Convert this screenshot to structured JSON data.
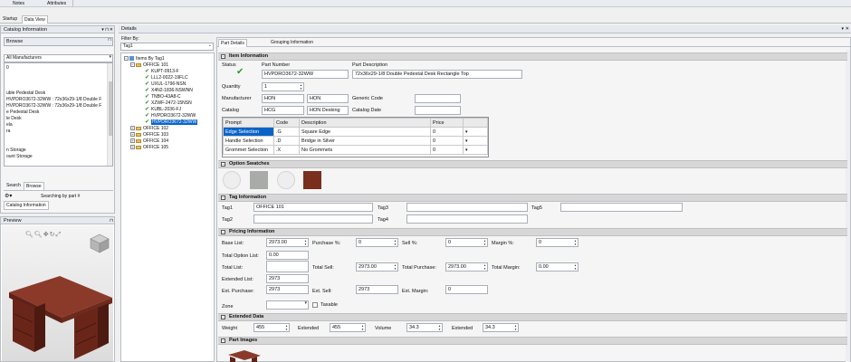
{
  "top_tabs": [
    "Notes",
    "Attributes"
  ],
  "view_tabs": [
    "Startup",
    "Data View"
  ],
  "catalog_panel": {
    "title": "Catalog Information",
    "browse_value": "Browse",
    "manufacturer_value": "All Manufacturers",
    "list_items": [
      "0",
      "",
      "",
      "",
      "uble Pedestal Desk",
      "HVPDRO3672-32WW : 72x36x29-1/8 Double F",
      "HVPDRO3672-32WW : 72x36x29-1/8 Double F",
      "e Pedestal Desk",
      "le Desk",
      "ela",
      "ra",
      "",
      "",
      "n Storage",
      "ount Storage"
    ],
    "tabs": [
      "Search",
      "Browse"
    ],
    "search_status": "Searching by part #",
    "catalog_info_button": "Catalog Information"
  },
  "preview_panel": {
    "title": "Preview"
  },
  "details": {
    "title": "Details",
    "filter_label": "Filter By:",
    "filter_value": "Tag1",
    "tree_root": "Items By Tag1",
    "tree_office101": "OFFICE 101",
    "tree_parts": [
      "KUPT-0913-F",
      "LLL2-0022-19FLC",
      "UXUL-1796-NSN",
      "X4N2-1836-NSWNN",
      "TNBO-43A8-C",
      "XZWF-2472-15NSN",
      "KUBL-2036-FJ",
      "HVPDRO3672-32WW",
      "HVPDRO3672-32WW"
    ],
    "tree_offices": [
      "OFFICE 102",
      "OFFICE 103",
      "OFFICE 104",
      "OFFICE 105"
    ],
    "tabs": [
      "Part Details",
      "Grouping Information"
    ]
  },
  "item_info": {
    "section": "Item Information",
    "status_label": "Status",
    "part_number_label": "Part Number",
    "part_number": "HVPDRO3672-32WW",
    "part_desc_label": "Part Description",
    "part_desc": "72x36x29-1/8 Double Pedestal Desk  Rectangle Top",
    "quantity_label": "Quantity",
    "quantity": "1",
    "manufacturer_label": "Manufacturer",
    "manufacturer_code": "HON",
    "manufacturer_name": "HON",
    "generic_code_label": "Generic Code",
    "catalog_label": "Catalog",
    "catalog_code": "HCG",
    "catalog_name": "HON Desking",
    "catalog_date_label": "Catalog Date"
  },
  "options_table": {
    "headers": [
      "Prompt",
      "Code",
      "Description",
      "Price"
    ],
    "rows": [
      [
        "Edge Selection",
        ".G",
        "Square Edge",
        "0"
      ],
      [
        "Handle Selection",
        ".D",
        "Bridge in Silver",
        "0"
      ],
      [
        "Grommet Selection",
        ".X",
        "No Grommets",
        "0"
      ]
    ]
  },
  "option_swatches": {
    "section": "Option Swatches",
    "colors": [
      "#eeeeee",
      "#a9aba9",
      "#eeeeee",
      "#7a2e1e"
    ]
  },
  "tag_info": {
    "section": "Tag Information",
    "tag1_label": "Tag1",
    "tag1": "OFFICE 101",
    "tag2_label": "Tag2",
    "tag3_label": "Tag3",
    "tag4_label": "Tag4",
    "tag5_label": "Tag5"
  },
  "pricing": {
    "section": "Pricing Information",
    "base_list_label": "Base List:",
    "base_list": "2973.00",
    "purchase_pct_label": "Purchase %:",
    "purchase_pct": "0",
    "sell_pct_label": "Sell %:",
    "sell_pct": "0",
    "margin_pct_label": "Margin %:",
    "margin_pct": "0",
    "total_option_list_label": "Total Option List:",
    "total_option_list": "0.00",
    "total_list_label": "Total List:",
    "total_sell_label": "Total Sell:",
    "total_sell": "2973.00",
    "total_purchase_label": "Total Purchase:",
    "total_purchase": "2973.00",
    "total_margin_label": "Total Margin:",
    "total_margin": "0.00",
    "extended_list_label": "Extended List:",
    "extended_list": "2973",
    "ext_purchase_label": "Ext. Purchase:",
    "ext_purchase": "2973",
    "ext_sell_label": "Ext. Sell:",
    "ext_sell": "2973",
    "ext_margin_label": "Ext. Margin:",
    "ext_margin": "0",
    "zone_label": "Zone",
    "taxable_label": "Taxable"
  },
  "extended_data": {
    "section": "Extended Data",
    "weight_label": "Weight",
    "weight": "455",
    "extended_label": "Extended",
    "extended": "455",
    "volume_label": "Volume",
    "volume": "34.3",
    "extended2_label": "Extended",
    "extended2": "34.3"
  },
  "part_images": {
    "section": "Part Images"
  },
  "colors": {
    "accent": "#0a64c8",
    "section_bg": "#d7d7d7",
    "wood": "#7a2e1e"
  }
}
